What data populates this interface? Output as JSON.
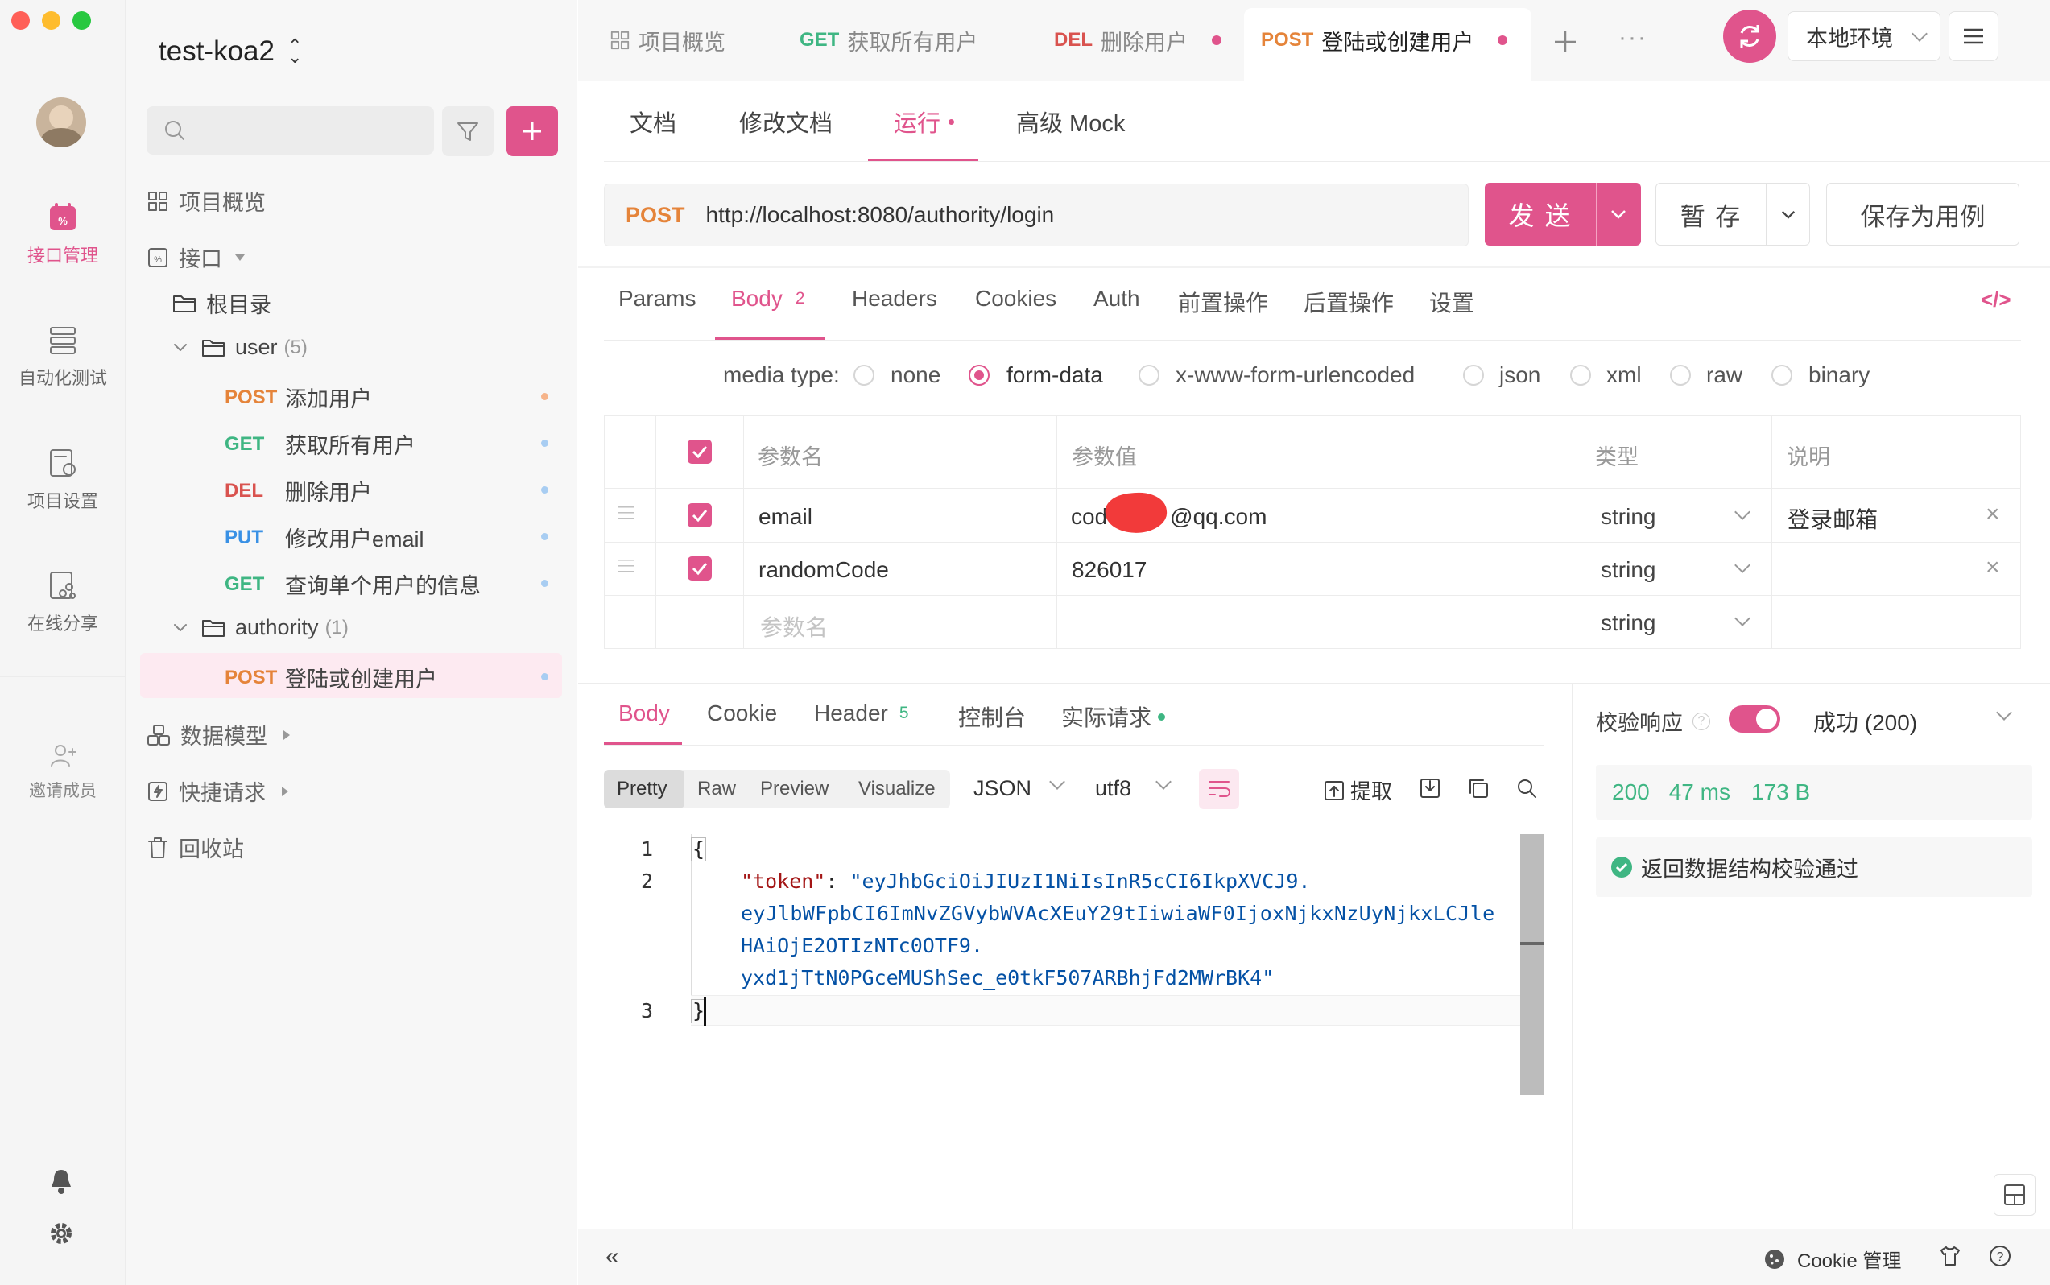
{
  "colors": {
    "accent": "#e0548c",
    "get": "#3fb683",
    "post": "#e5843a",
    "del": "#d9534f",
    "put": "#3a91e5"
  },
  "project": {
    "name": "test-koa2"
  },
  "rail": {
    "items": [
      "接口管理",
      "自动化测试",
      "项目设置",
      "在线分享"
    ],
    "invite": "邀请成员"
  },
  "sidebar": {
    "overview": "项目概览",
    "interfaces": "接口",
    "root": "根目录",
    "folders": [
      {
        "name": "user",
        "count": "(5)"
      },
      {
        "name": "authority",
        "count": "(1)"
      }
    ],
    "items": [
      {
        "method": "POST",
        "name": "添加用户"
      },
      {
        "method": "GET",
        "name": "获取所有用户"
      },
      {
        "method": "DEL",
        "name": "删除用户"
      },
      {
        "method": "PUT",
        "name": "修改用户email"
      },
      {
        "method": "GET",
        "name": "查询单个用户的信息"
      },
      {
        "method": "POST",
        "name": "登陆或创建用户"
      }
    ],
    "sections": [
      "数据模型",
      "快捷请求",
      "回收站"
    ]
  },
  "tabs": [
    {
      "method": "",
      "name": "项目概览"
    },
    {
      "method": "GET",
      "name": "获取所有用户"
    },
    {
      "method": "DEL",
      "name": "删除用户"
    },
    {
      "method": "POST",
      "name": "登陆或创建用户"
    }
  ],
  "env": "本地环境",
  "subtabs": [
    "文档",
    "修改文档",
    "运行",
    "高级 Mock"
  ],
  "request": {
    "method": "POST",
    "url": "http://localhost:8080/authority/login",
    "send": "发 送",
    "save": "暂 存",
    "save_case": "保存为用例"
  },
  "req_tabs": [
    {
      "label": "Params",
      "count": ""
    },
    {
      "label": "Body",
      "count": "2"
    },
    {
      "label": "Headers",
      "count": ""
    },
    {
      "label": "Cookies",
      "count": ""
    },
    {
      "label": "Auth",
      "count": ""
    },
    {
      "label": "前置操作",
      "count": ""
    },
    {
      "label": "后置操作",
      "count": ""
    },
    {
      "label": "设置",
      "count": ""
    }
  ],
  "media": {
    "label": "media type:",
    "options": [
      "none",
      "form-data",
      "x-www-form-urlencoded",
      "json",
      "xml",
      "raw",
      "binary"
    ],
    "selected": "form-data"
  },
  "params": {
    "headers": [
      "参数名",
      "参数值",
      "类型",
      "说明"
    ],
    "rows": [
      {
        "name": "email",
        "value_prefix": "cod",
        "value_suffix": "@qq.com",
        "type": "string",
        "desc": "登录邮箱"
      },
      {
        "name": "randomCode",
        "value": "826017",
        "type": "string",
        "desc": ""
      }
    ],
    "placeholder": "参数名",
    "placeholder_type": "string"
  },
  "resp_tabs": [
    {
      "label": "Body",
      "count": ""
    },
    {
      "label": "Cookie",
      "count": ""
    },
    {
      "label": "Header",
      "count": "5"
    },
    {
      "label": "控制台",
      "count": ""
    },
    {
      "label": "实际请求",
      "count": ""
    }
  ],
  "view_modes": [
    "Pretty",
    "Raw",
    "Preview",
    "Visualize"
  ],
  "format": "JSON",
  "encoding": "utf8",
  "extract": "提取",
  "code": {
    "line_numbers": [
      "1",
      "2",
      "3"
    ],
    "open": "{",
    "close": "}",
    "key": "\"token\"",
    "lines": [
      "\"eyJhbGciOiJIUzI1NiIsInR5cCI6IkpXVCJ9.",
      "eyJlbWFpbCI6ImNvZGVybWVAcXEuY29tIiwiaWF0IjoxNjkxNzUyNjkxLCJle",
      "HAiOjE2OTIzNTc0OTF9.",
      "yxd1jTtN0PGceMUShSec_e0tkF507ARBhjFd2MWrBK4\""
    ]
  },
  "validation": {
    "label": "校验响应",
    "result": "成功 (200)",
    "status": "200",
    "time": "47 ms",
    "size": "173 B",
    "passed": "返回数据结构校验通过"
  },
  "footer": {
    "cookie": "Cookie 管理"
  }
}
